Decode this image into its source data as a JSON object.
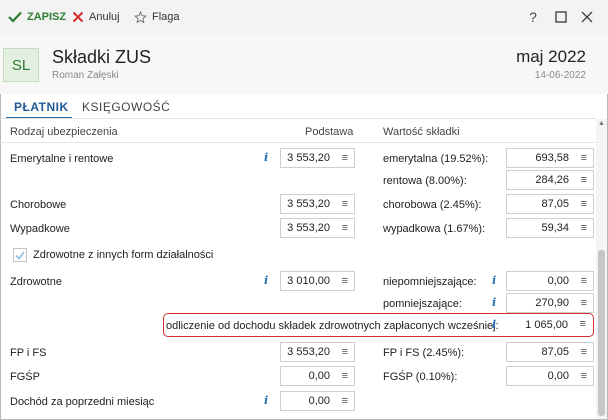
{
  "toolbar": {
    "save_label": "ZAPISZ",
    "cancel_label": "Anuluj",
    "flag_label": "Flaga",
    "help_label": "?"
  },
  "header": {
    "avatar": "SL",
    "title": "Składki ZUS",
    "subtitle": "Roman Załęski",
    "period": "maj 2022",
    "date": "14-06-2022"
  },
  "tabs": [
    {
      "label": "PŁATNIK",
      "active": true
    },
    {
      "label": "KSIĘGOWOŚĆ",
      "active": false
    }
  ],
  "columns": {
    "type": "Rodzaj ubezpieczenia",
    "base": "Podstawa",
    "value": "Wartość składki"
  },
  "rows": {
    "emerytalne": {
      "label": "Emerytalne i rentowe",
      "base": "3 553,20"
    },
    "emerytalna": {
      "label": "emerytalna (19.52%):",
      "value": "693,58"
    },
    "rentowa": {
      "label": "rentowa (8.00%):",
      "value": "284,26"
    },
    "chorobowe": {
      "label": "Chorobowe",
      "base": "3 553,20",
      "value_label": "chorobowa (2.45%):",
      "value": "87,05"
    },
    "wypadkowe": {
      "label": "Wypadkowe",
      "base": "3 553,20",
      "value_label": "wypadkowa (1.67%):",
      "value": "59,34"
    },
    "zdrowotne_checkbox": {
      "label": "Zdrowotne z innych form działalności",
      "checked": true
    },
    "zdrowotne": {
      "label": "Zdrowotne",
      "base": "3 010,00",
      "value_label": "niepomniejszające:",
      "value": "0,00"
    },
    "pomniejszajace": {
      "label": "pomniejszające:",
      "value": "270,90"
    },
    "odliczenie": {
      "label": "odliczenie od dochodu składek zdrowotnych zapłaconych wcześniej:",
      "value": "1 065,00"
    },
    "fp": {
      "label": "FP i FS",
      "base": "3 553,20",
      "value_label": "FP i FS (2.45%):",
      "value": "87,05"
    },
    "fgsp": {
      "label": "FGŚP",
      "base": "0,00",
      "value_label": "FGŚP (0.10%):",
      "value": "0,00"
    },
    "dochod": {
      "label": "Dochód za poprzedni miesiąc",
      "base": "0,00"
    }
  },
  "icons": {
    "info": "i",
    "calculator": "≡"
  },
  "colors": {
    "accent_green": "#2e7d32",
    "accent_blue": "#1f6fb5",
    "highlight_red": "#d32f2f"
  }
}
